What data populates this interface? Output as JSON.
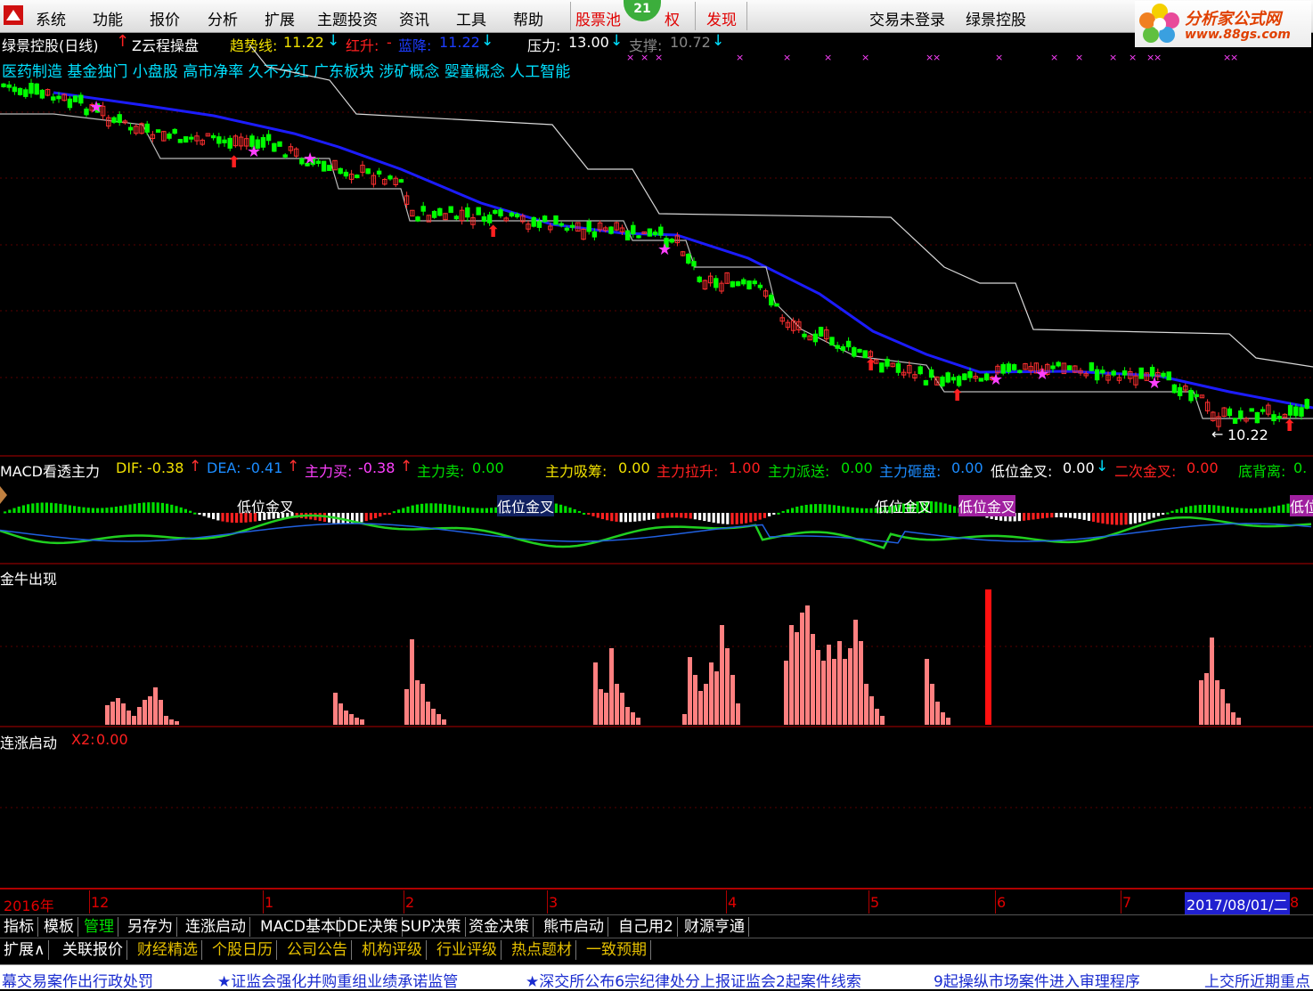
{
  "menubar": {
    "items": [
      "系统",
      "功能",
      "报价",
      "分析",
      "扩展",
      "主题投资",
      "资讯",
      "工具",
      "帮助"
    ],
    "stock_pool": "股票池",
    "right_tab": "权",
    "discover": "发现",
    "badge": "21",
    "login_status": "交易未登录",
    "account": "绿景控股",
    "logo_line1": "分析家公式网",
    "logo_line2": "www.88gs.com"
  },
  "main_chart": {
    "stock_title": "绿景控股(日线)",
    "indicator_name": "Z云程操盘",
    "trend_label": "趋势线:",
    "trend_value": "11.22",
    "red_up_label": "红升:",
    "red_up_value": "-",
    "blue_down_label": "蓝降:",
    "blue_down_value": "11.22",
    "pressure_label": "压力:",
    "pressure_value": "13.00",
    "support_label": "支撑:",
    "support_value": "10.72",
    "concepts": "医药制造 基金独门 小盘股 高市净率 久不分红 广东板块 涉矿概念 婴童概念 人工智能",
    "low_price_label": "10.22",
    "colors": {
      "ma_blue": "#1c1cff",
      "resistance": "#d0d0d0",
      "up": "#ff3030",
      "down": "#00ff00"
    }
  },
  "macd_pane": {
    "title": "MACD看透主力",
    "dif_label": "DIF:",
    "dif_value": "-0.38",
    "dea_label": "DEA:",
    "dea_value": "-0.41",
    "main_buy_label": "主力买:",
    "main_buy_value": "-0.38",
    "main_sell_label": "主力卖:",
    "main_sell_value": "0.00",
    "absorb_label": "主力吸筹:",
    "absorb_value": "0.00",
    "pull_label": "主力拉升:",
    "pull_value": "1.00",
    "dispatch_label": "主力派送:",
    "dispatch_value": "0.00",
    "smash_label": "主力砸盘:",
    "smash_value": "0.00",
    "low_gold_label": "低位金叉:",
    "low_gold_value": "0.00",
    "second_gold_label": "二次金叉:",
    "second_gold_value": "0.00",
    "bottom_div_label": "底背离:",
    "bottom_div_value": "0.",
    "markers": [
      "低位金叉",
      "低位金叉",
      "低位金叉",
      "低位金叉",
      "低位"
    ]
  },
  "bull_pane": {
    "title": "金牛出现"
  },
  "lianzhang_pane": {
    "title": "连涨启动",
    "x2_label": "X2:",
    "x2_value": "0.00"
  },
  "date_axis": {
    "labels": [
      "2016年",
      "12",
      "1",
      "2",
      "3",
      "4",
      "5",
      "6",
      "7"
    ],
    "current_date": "2017/08/01/二",
    "last_label": "8"
  },
  "tabs_row1": [
    "指标",
    "模板",
    "管理",
    "另存为",
    "连涨启动",
    "MACD基本",
    "DDE决策",
    "SUP决策",
    "资金决策",
    "熊市启动",
    "自己用2",
    "财源亨通"
  ],
  "tabs_row2": [
    "扩展∧",
    "关联报价",
    "财经精选",
    "个股日历",
    "公司公告",
    "机构评级",
    "行业评级",
    "热点题材",
    "一致预期"
  ],
  "ticker": [
    "幕交易案作出行政处罚",
    "★证监会强化并购重组业绩承诺监管",
    "★深交所公布6宗纪律处分上报证监会2起案件线索",
    "9起操纵市场案件进入审理程序",
    "上交所近期重点"
  ]
}
